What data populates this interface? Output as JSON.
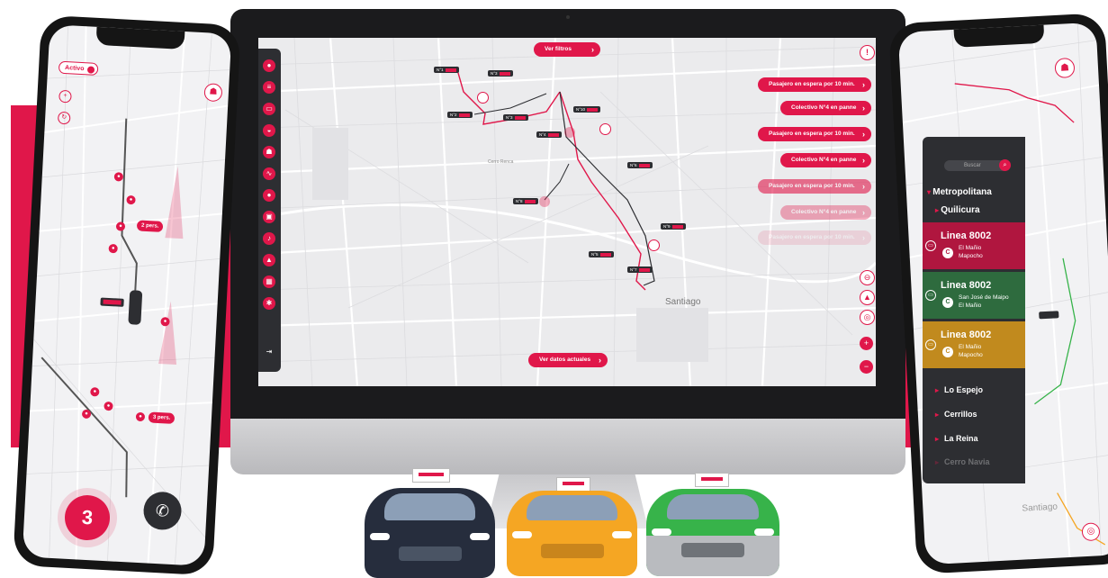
{
  "desktop": {
    "top_button": "Ver filtros",
    "bottom_button": "Ver datos actuales",
    "alert_badge": "!",
    "city_label": "Santiago",
    "side_alerts": [
      {
        "label": "Pasajero en espera por 10 min.",
        "faded": false
      },
      {
        "label": "Colectivo N°4 en panne",
        "faded": false
      },
      {
        "label": "Pasajero en espera por 10 min.",
        "faded": false
      },
      {
        "label": "Colectivo N°4 en panne",
        "faded": false
      },
      {
        "label": "Pasajero en espera por 10 min.",
        "faded": true
      },
      {
        "label": "Colectivo N°4 en panne",
        "faded": true
      },
      {
        "label": "Pasajero en espera por 10 min.",
        "faded": true
      }
    ],
    "map_controls": [
      "+",
      "−"
    ],
    "map_labels": [
      "Cerro Renca",
      "Santiago"
    ]
  },
  "left_phone": {
    "status_toggle": "Activo",
    "pins": [
      {
        "label": "2 pers."
      },
      {
        "label": "3 pers."
      }
    ],
    "counter": "3",
    "call_icon": "phone-icon"
  },
  "right_phone": {
    "search_placeholder": "Buscar",
    "region": "Metropolitana",
    "commune": "Quilicura",
    "lines": [
      {
        "title": "Linea 8002",
        "stops": [
          "El Mañio",
          "Mapocho"
        ],
        "color": "#b0163f"
      },
      {
        "title": "Linea 8002",
        "stops": [
          "San José de Maipo",
          "El Mañio"
        ],
        "color": "#2e6b3e"
      },
      {
        "title": "Linea 8002",
        "stops": [
          "El Mañio",
          "Mapocho"
        ],
        "color": "#c18a1e"
      }
    ],
    "cities": [
      "Lo Espejo",
      "Cerrillos",
      "La Reina",
      "Cerro Navia"
    ],
    "map_label": "Santiago"
  },
  "colors": {
    "accent": "#e0174a",
    "dark": "#2d2e32",
    "yellow": "#f5a623",
    "green": "#37b34a"
  }
}
